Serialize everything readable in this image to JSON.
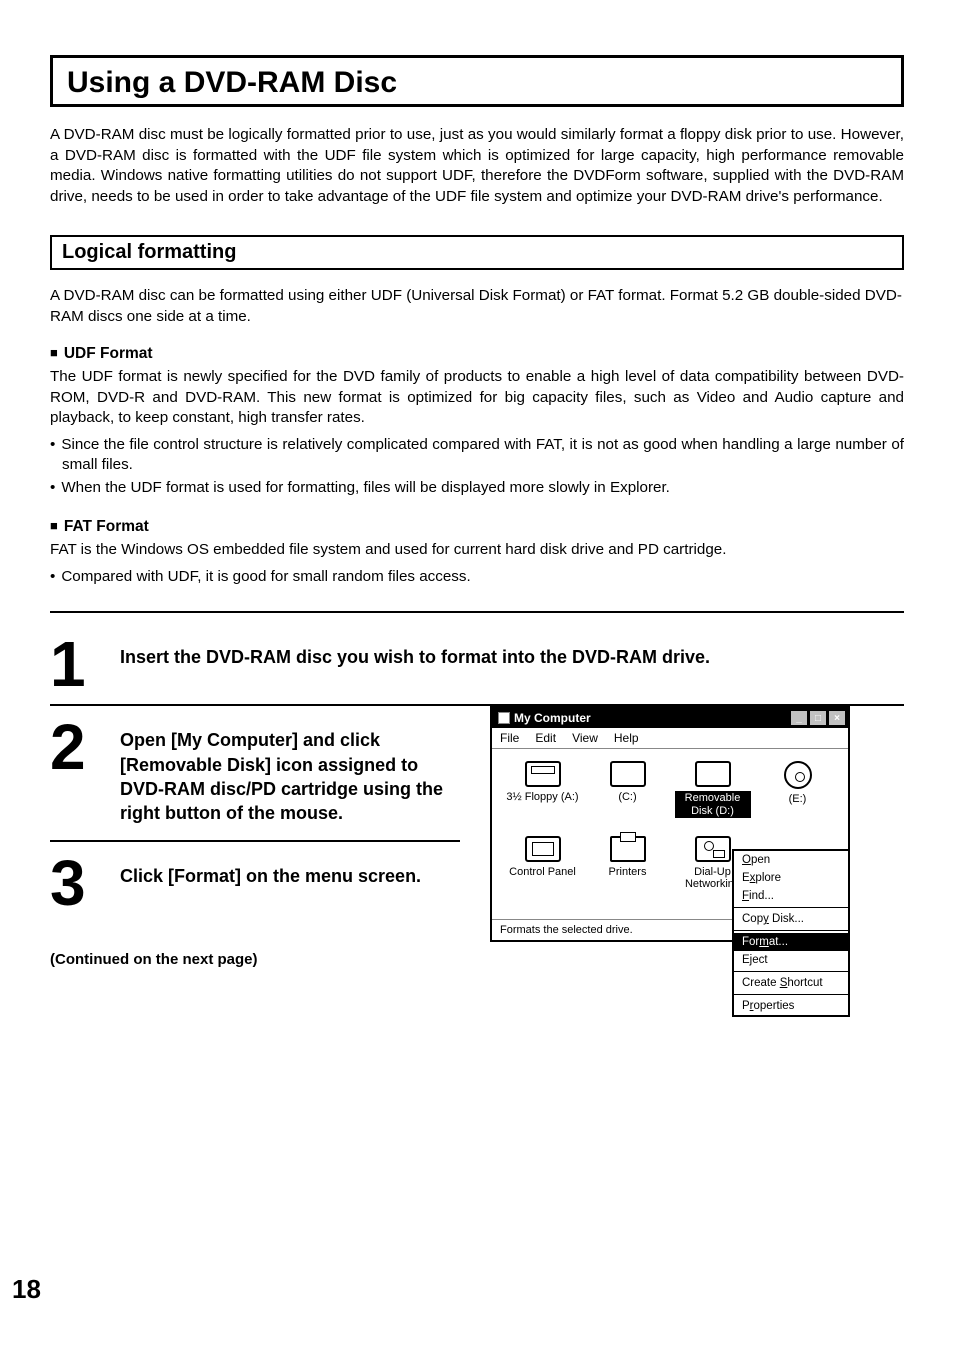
{
  "title": "Using a DVD-RAM Disc",
  "intro": "A DVD-RAM disc must be logically formatted prior to use, just as you would similarly format a floppy disk prior to use.\nHowever, a DVD-RAM disc is formatted with the UDF file system which is optimized for large capacity, high performance removable media. Windows native formatting utilities do not support UDF, therefore the DVDForm software, supplied with the DVD-RAM drive, needs to be used in order to take advantage of the UDF file system and optimize your DVD-RAM drive's performance.",
  "section": {
    "heading": "Logical formatting",
    "intro": "A DVD-RAM disc can be formatted using either UDF (Universal Disk Format) or FAT format.\nFormat 5.2 GB double-sided DVD-RAM discs one side at a time.",
    "udf": {
      "heading": "UDF Format",
      "body": "The UDF format is newly specified for the DVD family of products to enable a high level of data compatibility between DVD-ROM, DVD-R and DVD-RAM. This new format is optimized for big capacity files, such as Video and Audio capture and playback, to keep constant, high transfer rates.",
      "bullets": [
        "Since the file control structure is relatively complicated compared with FAT, it is not as good when handling a large number of small files.",
        "When the UDF format is used for formatting, files will be displayed more slowly in Explorer."
      ]
    },
    "fat": {
      "heading": "FAT Format",
      "body": "FAT is the Windows OS embedded file system and used for current hard disk drive and PD cartridge.",
      "bullets": [
        "Compared with UDF, it is good for small random files access."
      ]
    }
  },
  "steps": [
    {
      "num": "1",
      "text": "Insert the DVD-RAM disc you wish to format into the DVD-RAM drive."
    },
    {
      "num": "2",
      "text": "Open [My Computer] and click [Removable Disk] icon assigned to DVD-RAM disc/PD cartridge using the right button of the mouse."
    },
    {
      "num": "3",
      "text": "Click [Format] on the menu screen."
    }
  ],
  "continued": "(Continued on the next page)",
  "page_number": "18",
  "mycomputer": {
    "title": "My Computer",
    "menu": {
      "file": "File",
      "edit": "Edit",
      "view": "View",
      "help": "Help"
    },
    "icons": {
      "floppy": "3½ Floppy (A:)",
      "c": "(C:)",
      "removable": "Removable Disk (D:)",
      "e": "(E:)",
      "cp": "Control Panel",
      "printers": "Printers",
      "dialup": "Dial-Up Networking"
    },
    "status": "Formats the selected drive.",
    "context": {
      "open": "Open",
      "explore": "Explore",
      "find": "Find...",
      "copydisk": "Copy Disk...",
      "format": "Format...",
      "eject": "Eject",
      "shortcut": "Create Shortcut",
      "properties": "Properties"
    }
  }
}
